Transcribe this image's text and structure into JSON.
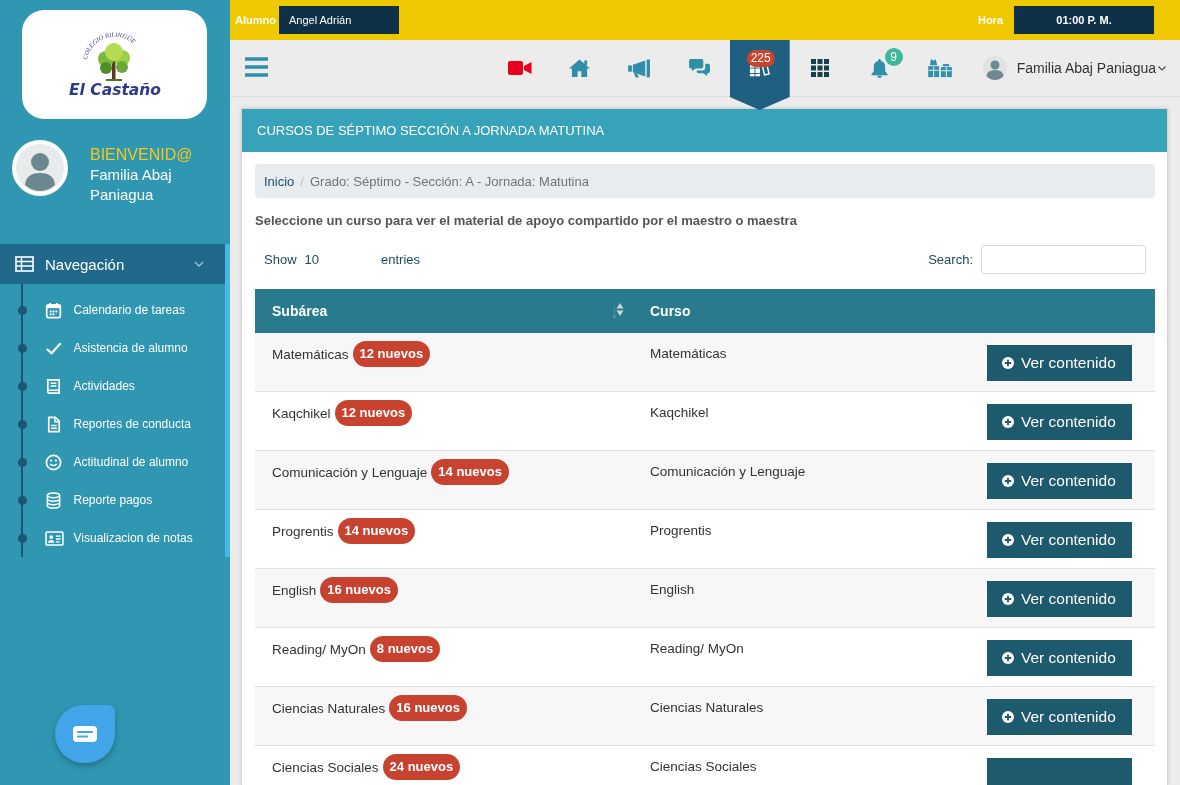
{
  "sidebar": {
    "logo": {
      "arc_text": "COLEGIO BILINGÜE",
      "name": "El Castaño"
    },
    "greeting": "BIENVENID@",
    "user_name": "Familia Abaj Paniagua",
    "navigation": {
      "label": "Navegación",
      "expanded": true,
      "items": [
        {
          "label": "Calendario de tareas"
        },
        {
          "label": "Asistencia de alumno"
        },
        {
          "label": "Actividades"
        },
        {
          "label": "Reportes de conducta"
        },
        {
          "label": "Actitudinal de alumno"
        },
        {
          "label": "Reporte pagos"
        },
        {
          "label": "Visualizacion de notas"
        }
      ]
    }
  },
  "top_bar": {
    "student_label": "Alumno",
    "student": "Angel Adrián",
    "time_label": "Hora",
    "time": "01:00 P. M."
  },
  "toolbar": {
    "items": [
      {
        "selected": false
      },
      {
        "selected": false
      },
      {
        "selected": false
      },
      {
        "selected": false
      },
      {
        "selected": true,
        "badge": {
          "text": "225",
          "color": "#c9432f"
        }
      },
      {
        "selected": false
      },
      {
        "selected": false,
        "badge": {
          "text": "9",
          "color": "#3cb89b"
        }
      },
      {
        "selected": false
      }
    ],
    "user": {
      "name": "Familia Abaj Paniagua"
    }
  },
  "panel": {
    "title": "CURSOS DE SÉPTIMO SECCIÓN A JORNADA MATUTINA",
    "breadcrumb": {
      "separator": "/",
      "items": [
        {
          "label": "Inicio",
          "kind": "link"
        },
        {
          "label": "Grado: Séptimo - Sección: A - Jornada: Matutina",
          "kind": "current"
        }
      ]
    },
    "intro": "Seleccione un curso para ver el material de apoyo compartido por el maestro o maestra",
    "length_menu": {
      "label_before": "Show",
      "value": "10",
      "label_after": "entries"
    },
    "search": {
      "label": "Search:"
    },
    "table": {
      "columns": [
        {
          "label": "Subárea",
          "sortable": true
        },
        {
          "label": "Curso",
          "sortable": false
        }
      ],
      "rows": [
        {
          "subarea": "Matemáticas",
          "new_count": "12 nuevos",
          "course": "Matemáticas",
          "action": "Ver contenido"
        },
        {
          "subarea": "Kaqchikel",
          "new_count": "12 nuevos",
          "course": "Kaqchikel",
          "action": "Ver contenido"
        },
        {
          "subarea": "Comunicación y Lenguaje",
          "new_count": "14 nuevos",
          "course": "Comunicación y Lenguaje",
          "action": "Ver contenido"
        },
        {
          "subarea": "Progrentis",
          "new_count": "14 nuevos",
          "course": "Progrentis",
          "action": "Ver contenido"
        },
        {
          "subarea": "English",
          "new_count": "16 nuevos",
          "course": "English",
          "action": "Ver contenido"
        },
        {
          "subarea": "Reading/ MyOn",
          "new_count": "8 nuevos",
          "course": "Reading/ MyOn",
          "action": "Ver contenido"
        },
        {
          "subarea": "Ciencias Naturales",
          "new_count": "16 nuevos",
          "course": "Ciencias Naturales",
          "action": "Ver contenido"
        },
        {
          "subarea": "Ciencias Sociales",
          "new_count": "24 nuevos",
          "course": "Ciencias Sociales"
        }
      ]
    }
  }
}
